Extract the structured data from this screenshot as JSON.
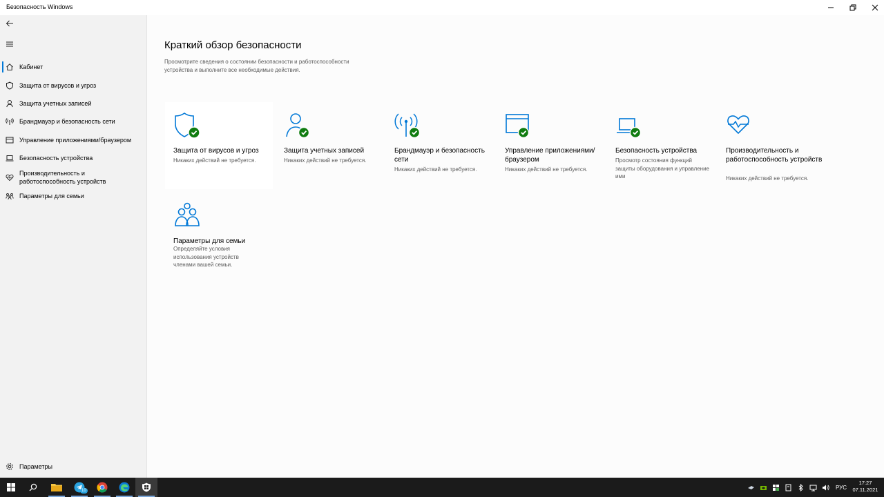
{
  "window": {
    "title": "Безопасность Windows"
  },
  "sidebar": {
    "items": [
      {
        "label": "Кабинет",
        "icon": "home-icon"
      },
      {
        "label": "Защита от вирусов и угроз",
        "icon": "shield-icon"
      },
      {
        "label": "Защита учетных записей",
        "icon": "person-icon"
      },
      {
        "label": "Брандмауэр и безопасность сети",
        "icon": "antenna-icon"
      },
      {
        "label": "Управление приложениями/браузером",
        "icon": "browser-window-icon"
      },
      {
        "label": "Безопасность устройства",
        "icon": "laptop-icon"
      },
      {
        "label": "Производительность и работоспособность устройств",
        "icon": "heart-pulse-icon"
      },
      {
        "label": "Параметры для семьи",
        "icon": "family-icon"
      }
    ],
    "settings_label": "Параметры"
  },
  "main": {
    "title": "Краткий обзор безопасности",
    "description": "Просмотрите сведения о состоянии безопасности и работоспособности устройства и выполните все необходимые действия.",
    "cards": [
      {
        "title": "Защита от вирусов и угроз",
        "desc": "Никаких действий не требуется.",
        "icon": "shield-icon",
        "status": "ok"
      },
      {
        "title": "Защита учетных записей",
        "desc": "Никаких действий не требуется.",
        "icon": "person-icon",
        "status": "ok"
      },
      {
        "title": "Брандмауэр и безопасность сети",
        "desc": "Никаких действий не требуется.",
        "icon": "antenna-icon",
        "status": "ok"
      },
      {
        "title": "Управление приложениями/браузером",
        "desc": "Никаких действий не требуется.",
        "icon": "browser-window-icon",
        "status": "ok"
      },
      {
        "title": "Безопасность устройства",
        "desc": "Просмотр состояния функций защиты оборудования и управление ими",
        "icon": "laptop-icon",
        "status": "ok"
      },
      {
        "title": "Производительность и работоспособность устройств",
        "desc": "Никаких действий не требуется.",
        "icon": "heart-pulse-icon",
        "status": "none"
      },
      {
        "title": "Параметры для семьи",
        "desc": "Определяйте условия использования устройств членами вашей семьи.",
        "icon": "family-icon",
        "status": "none"
      }
    ]
  },
  "taskbar": {
    "apps": [
      "start-icon",
      "search-icon",
      "file-explorer-icon",
      "telegram-icon",
      "chrome-icon",
      "edge-icon",
      "windows-security-icon"
    ],
    "telegram_badge": "10",
    "language": "РУС",
    "time": "17:27",
    "date": "07.11.2021"
  },
  "colors": {
    "accent": "#0078d7",
    "ok_green": "#107c10",
    "sidebar_bg": "#f2f2f2",
    "taskbar_bg": "#1b1b1b"
  }
}
